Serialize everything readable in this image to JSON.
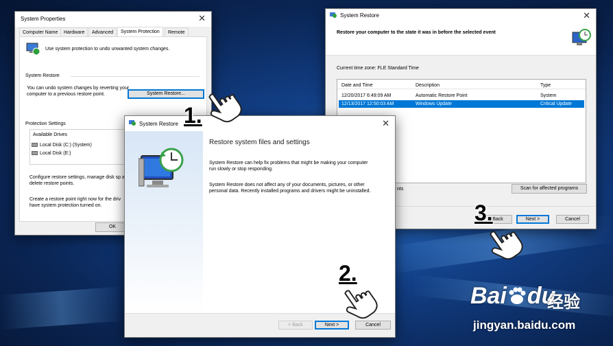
{
  "system_properties": {
    "title": "System Properties",
    "tabs": [
      "Computer Name",
      "Hardware",
      "Advanced",
      "System Protection",
      "Remote"
    ],
    "active_tab": "System Protection",
    "intro": "Use system protection to undo unwanted system changes.",
    "restore_heading": "System Restore",
    "restore_text": "You can undo system changes by reverting your computer to a previous restore point.",
    "restore_button": "System Restore...",
    "protection_heading": "Protection Settings",
    "drives_header": "Available Drives",
    "drives": [
      "Local Disk (C:) (System)",
      "Local Disk (E:)"
    ],
    "configure_text": "Configure restore settings, manage disk sp and delete restore points.",
    "create_text": "Create a restore point right now for the driv have system protection turned on.",
    "ok_button": "OK"
  },
  "wizard_intro": {
    "title": "System Restore",
    "heading": "Restore system files and settings",
    "para1": "System Restore can help fix problems that might be making your computer run slowly or stop responding.",
    "para2": "System Restore does not affect any of your documents, pictures, or other personal data. Recently installed programs and drivers might be uninstalled.",
    "back_button": "< Back",
    "next_button": "Next >",
    "cancel_button": "Cancel"
  },
  "wizard_points": {
    "title": "System Restore",
    "header": "Restore your computer to the state it was in before the selected event",
    "timezone": "Current time zone: FLE Standard Time",
    "columns": [
      "Date and Time",
      "Description",
      "Type"
    ],
    "rows": [
      {
        "date": "12/20/2017 6:49:09 AM",
        "desc": "Automatic Restore Point",
        "type": "System",
        "selected": false
      },
      {
        "date": "12/13/2017 12:50:03 AM",
        "desc": "Windows Update",
        "type": "Critical Update",
        "selected": true
      }
    ],
    "more_points_fragment": "nts",
    "scan_button": "Scan for affected programs",
    "back_button": "< Back",
    "next_button": "Next >",
    "cancel_button": "Cancel"
  },
  "steps": [
    "1.",
    "2.",
    "3."
  ],
  "watermark": {
    "brand": "Bai",
    "brand2": "du",
    "chinese": "经验",
    "url": "jingyan.baidu.com"
  },
  "colors": {
    "selection": "#0078d7",
    "desktop": "#123f86"
  }
}
